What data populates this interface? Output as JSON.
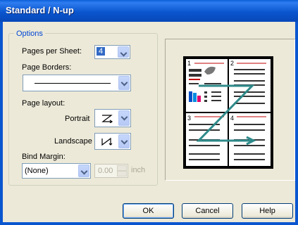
{
  "window": {
    "title": "Standard / N-up"
  },
  "options": {
    "group_label": "Options",
    "pages_per_sheet": {
      "label": "Pages per Sheet:",
      "value": "4"
    },
    "page_borders": {
      "label": "Page Borders:"
    },
    "page_layout": {
      "label": "Page layout:",
      "portrait_label": "Portrait",
      "portrait_icon": "z-order-icon",
      "landscape_label": "Landscape",
      "landscape_icon": "n-order-icon"
    },
    "bind_margin": {
      "label": "Bind Margin:",
      "value": "(None)",
      "amount": "0.00",
      "unit": "inch"
    }
  },
  "preview": {
    "page_numbers": [
      "1",
      "2",
      "3",
      "4"
    ]
  },
  "buttons": {
    "ok": "OK",
    "cancel": "Cancel",
    "help": "Help"
  },
  "colors": {
    "titlebar": "#0a56cf",
    "group_label": "#0046d5",
    "selection": "#316ac5",
    "path_line": "#2f8a8a"
  }
}
